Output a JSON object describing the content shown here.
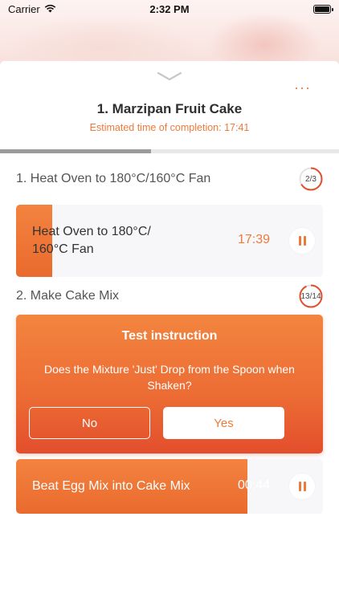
{
  "status_bar": {
    "carrier": "Carrier",
    "time": "2:32 PM"
  },
  "header": {
    "title": "1. Marzipan Fruit Cake",
    "subtitle": "Estimated time of completion: 17:41",
    "more_label": "···"
  },
  "progress": {
    "fraction": 0.445
  },
  "steps": [
    {
      "title": "1. Heat Oven to 180°C/160°C Fan",
      "counter": "2/3",
      "counter_fraction": 0.667,
      "card": {
        "text_line1": "Heat Oven to 180°C/",
        "text_line2": "160°C Fan",
        "time": "17:39",
        "fill_fraction": 0.117
      }
    },
    {
      "title": "2. Make Cake Mix",
      "counter": "13/14",
      "counter_fraction": 0.93,
      "test": {
        "title": "Test instruction",
        "question": "Does the Mixture 'Just' Drop from the Spoon when Shaken?",
        "no_label": "No",
        "yes_label": "Yes"
      },
      "card": {
        "text": "Beat Egg Mix into Cake Mix",
        "time": "00:44",
        "fill_fraction": 0.754
      }
    }
  ],
  "colors": {
    "accent": "#ee7a3a",
    "accent_dark": "#e34e2c",
    "progress_gray": "#9b9b9b"
  },
  "icons": [
    "wifi-icon",
    "battery-icon",
    "chevron-down-icon",
    "more-icon",
    "pause-icon"
  ]
}
